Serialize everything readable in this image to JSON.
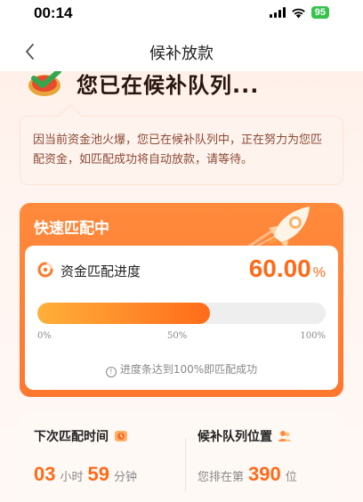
{
  "status_bar": {
    "time": "00:14",
    "battery": "95"
  },
  "nav": {
    "back_icon": "chevron-left-icon",
    "title": "候补放款"
  },
  "hero": {
    "title": "您已在候补队列..."
  },
  "notice": {
    "text": "因当前资金池火爆，您已在候补队列中，正在努力为您匹配资金，如匹配成功将自动放款，请等待。"
  },
  "match": {
    "header": "快速匹配中",
    "progress_label": "资金匹配进度",
    "progress_value": "60.00",
    "progress_unit": "%",
    "progress_fraction": 0.6,
    "ticks": [
      "0%",
      "50%",
      "100%"
    ],
    "hint": "进度条达到100%即匹配成功"
  },
  "info": {
    "next_time_title": "下次匹配时间",
    "hours": "03",
    "hours_unit": "小时",
    "minutes": "59",
    "minutes_unit": "分钟",
    "queue_title": "候补队列位置",
    "queue_prefix": "您排在第",
    "queue_number": "390",
    "queue_suffix": "位"
  },
  "colors": {
    "accent": "#ff6a1a",
    "card_orange": "#ff7f35",
    "battery_green": "#36c24b"
  }
}
